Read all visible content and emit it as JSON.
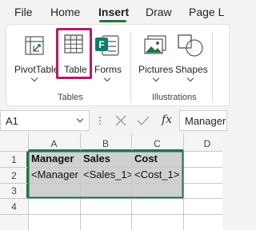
{
  "menu": {
    "tabs": [
      {
        "label": "File"
      },
      {
        "label": "Home"
      },
      {
        "label": "Insert"
      },
      {
        "label": "Draw"
      },
      {
        "label": "Page L"
      }
    ],
    "active_tab": "Insert"
  },
  "ribbon": {
    "buttons": {
      "pivottable": "PivotTable",
      "table": "Table",
      "forms": "Forms",
      "pictures": "Pictures",
      "shapes": "Shapes"
    },
    "groups": {
      "tables": "Tables",
      "illustrations": "Illustrations"
    },
    "icons": {
      "pivottable": "pivottable-icon",
      "table": "table-icon",
      "forms": "forms-icon",
      "pictures": "pictures-icon",
      "shapes": "shapes-icon"
    }
  },
  "formula_bar": {
    "name_box": "A1",
    "fx": "fx",
    "content": "Manager"
  },
  "grid": {
    "columns": [
      "A",
      "B",
      "C",
      "D"
    ],
    "rows": [
      "1",
      "2",
      "3",
      "4"
    ],
    "cells": {
      "A1": "Manager",
      "B1": "Sales",
      "C1": "Cost",
      "A2": "<Manager",
      "B2": "<Sales_1>",
      "C2": "<Cost_1>"
    }
  },
  "colors": {
    "excel_green": "#217346",
    "highlight": "#b5196a",
    "selection_fill": "#d0d0d0"
  }
}
